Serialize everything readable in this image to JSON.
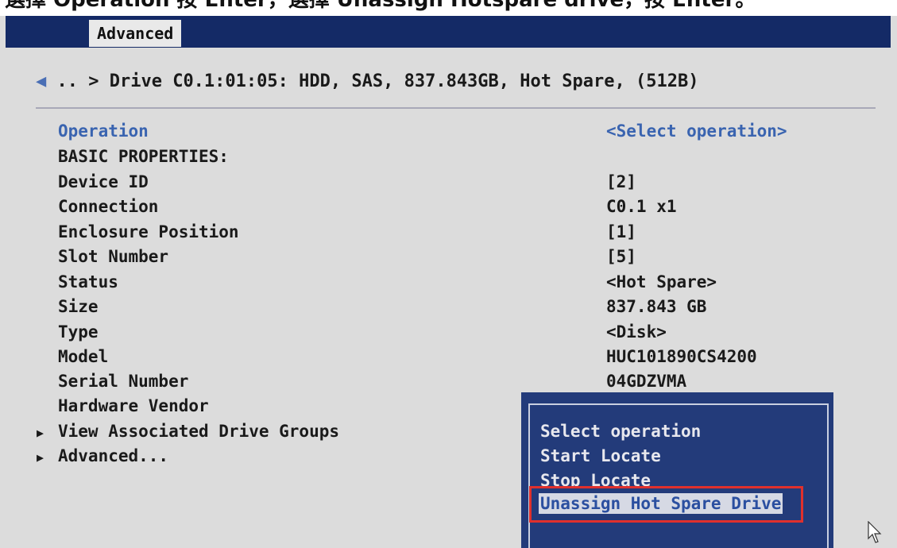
{
  "caption": "選擇 Operation 按 Enter，選擇 Unassign Hotspare drive，按 Enter。",
  "header": {
    "tab": "Advanced"
  },
  "breadcrumb": {
    "back_arrow": "◀",
    "text": ".. > Drive C0.1:01:05: HDD, SAS, 837.843GB, Hot Spare, (512B)"
  },
  "rows": [
    {
      "label": "Operation",
      "value": "<Select operation>"
    },
    {
      "label": "BASIC PROPERTIES:",
      "value": ""
    },
    {
      "label": "Device ID",
      "value": "[2]"
    },
    {
      "label": "Connection",
      "value": "C0.1 x1"
    },
    {
      "label": "Enclosure Position",
      "value": "[1]"
    },
    {
      "label": "Slot Number",
      "value": "[5]"
    },
    {
      "label": "Status",
      "value": "<Hot Spare>"
    },
    {
      "label": "Size",
      "value": "837.843 GB"
    },
    {
      "label": "Type",
      "value": "<Disk>"
    },
    {
      "label": "Model",
      "value": "HUC101890CS4200"
    },
    {
      "label": "Serial Number",
      "value": "04GDZVMA"
    },
    {
      "label": "Hardware Vendor",
      "value": ""
    },
    {
      "label": "View Associated Drive Groups",
      "value": ""
    },
    {
      "label": "Advanced...",
      "value": ""
    }
  ],
  "expand_glyph": "▶",
  "popup": {
    "options": [
      "Select operation",
      "Start Locate",
      "Stop Locate",
      "Unassign Hot Spare Drive"
    ],
    "selected_index": 3
  },
  "colors": {
    "header_bg": "#142a66",
    "popup_bg": "#233b7a",
    "link": "#3a64b0",
    "highlight_box": "#e0302c"
  },
  "icons": {
    "cursor": "mouse-pointer-icon",
    "back": "left-arrow-icon",
    "expand": "triangle-right-icon"
  }
}
